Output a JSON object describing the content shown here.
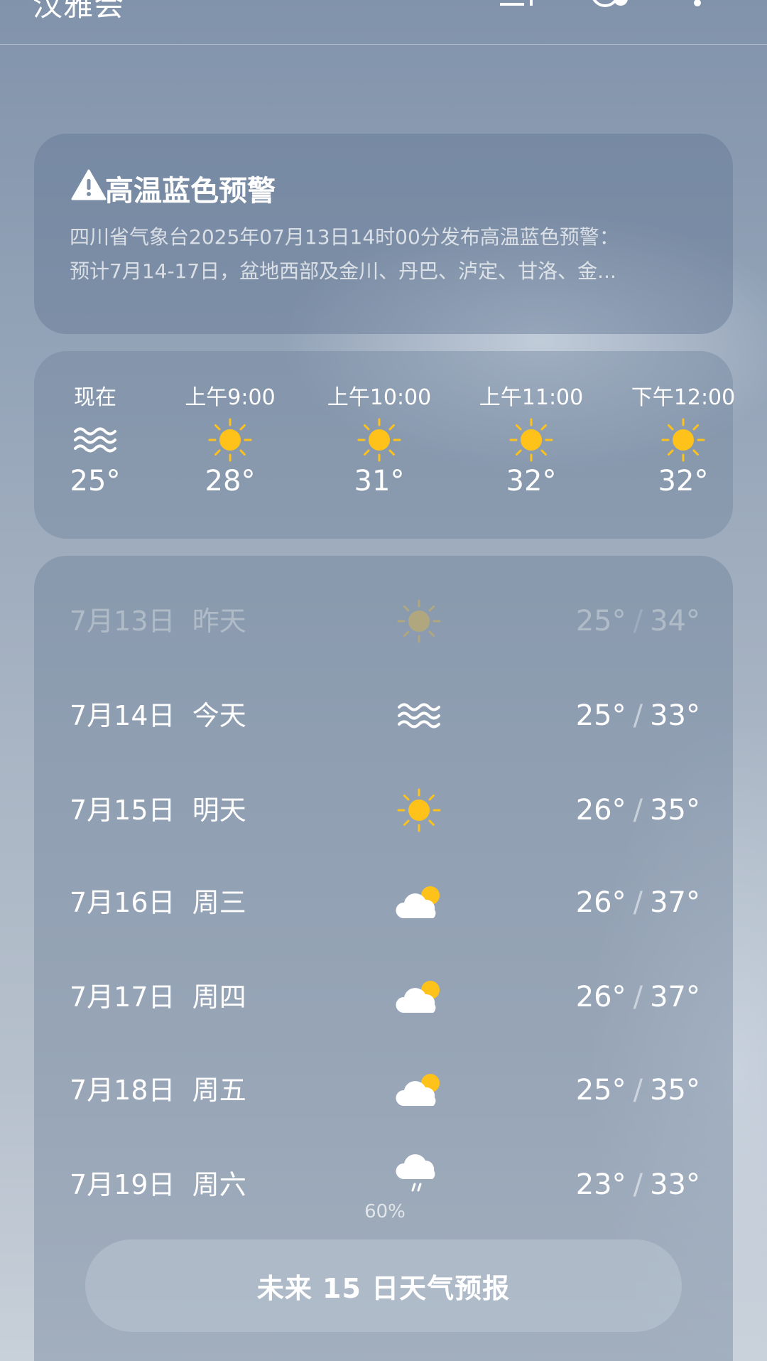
{
  "header": {
    "city_partial": "汉雅会"
  },
  "alert": {
    "title": "高温蓝色预警",
    "line1": "四川省气象台2025年07月13日14时00分发布高温蓝色预警：",
    "line2": "预计7月14-17日，盆地西部及金川、丹巴、泸定、甘洛、金..."
  },
  "hourly": [
    {
      "label": "现在",
      "temp": "25°",
      "icon": "haze-icon"
    },
    {
      "label": "上午9:00",
      "temp": "28°",
      "icon": "sun-icon"
    },
    {
      "label": "上午10:00",
      "temp": "31°",
      "icon": "sun-icon"
    },
    {
      "label": "上午11:00",
      "temp": "32°",
      "icon": "sun-icon"
    },
    {
      "label": "下午12:00",
      "temp": "32°",
      "icon": "sun-icon"
    }
  ],
  "daily": [
    {
      "date": "7月13日",
      "day": "昨天",
      "low": "25°",
      "high": "34°",
      "icon": "sun-icon"
    },
    {
      "date": "7月14日",
      "day": "今天",
      "low": "25°",
      "high": "33°",
      "icon": "haze-icon"
    },
    {
      "date": "7月15日",
      "day": "明天",
      "low": "26°",
      "high": "35°",
      "icon": "sun-icon"
    },
    {
      "date": "7月16日",
      "day": "周三",
      "low": "26°",
      "high": "37°",
      "icon": "partly-cloudy-icon"
    },
    {
      "date": "7月17日",
      "day": "周四",
      "low": "26°",
      "high": "37°",
      "icon": "partly-cloudy-icon"
    },
    {
      "date": "7月18日",
      "day": "周五",
      "low": "25°",
      "high": "35°",
      "icon": "partly-cloudy-icon"
    },
    {
      "date": "7月19日",
      "day": "周六",
      "low": "23°",
      "high": "33°",
      "icon": "rain-icon",
      "precip": "60%"
    }
  ],
  "separator": "/",
  "forecast_button": "未来 15 日天气预报",
  "colors": {
    "sun": "#FFC21A",
    "text": "#FFFFFF"
  }
}
